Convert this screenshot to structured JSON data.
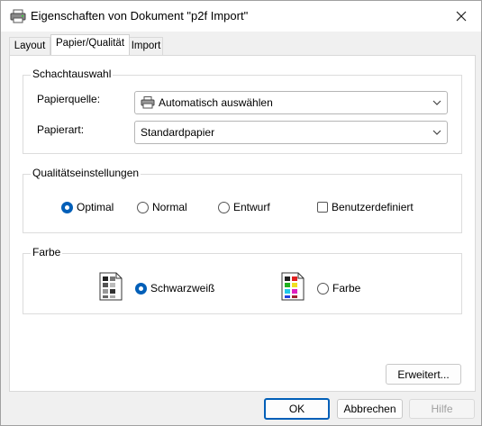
{
  "window": {
    "title": "Eigenschaften von Dokument \"p2f Import\""
  },
  "tabs": [
    {
      "label": "Layout"
    },
    {
      "label": "Papier/Qualität"
    },
    {
      "label": "Import"
    }
  ],
  "schacht": {
    "legend": "Schachtauswahl",
    "papierquelle_label": "Papierquelle:",
    "papierquelle_value": "Automatisch auswählen",
    "papierart_label": "Papierart:",
    "papierart_value": "Standardpapier"
  },
  "qualitaet": {
    "legend": "Qualitätseinstellungen",
    "options": [
      {
        "label": "Optimal",
        "selected": true
      },
      {
        "label": "Normal",
        "selected": false
      },
      {
        "label": "Entwurf",
        "selected": false
      }
    ],
    "custom_label": "Benutzerdefiniert",
    "custom_checked": false
  },
  "farbe": {
    "legend": "Farbe",
    "options": [
      {
        "label": "Schwarzweiß",
        "selected": true
      },
      {
        "label": "Farbe",
        "selected": false
      }
    ]
  },
  "buttons": {
    "advanced": "Erweitert...",
    "ok": "OK",
    "cancel": "Abbrechen",
    "help": "Hilfe"
  }
}
